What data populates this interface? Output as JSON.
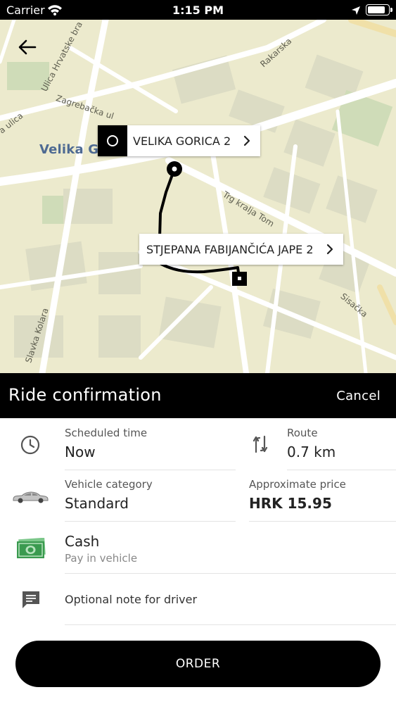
{
  "status_bar": {
    "carrier": "Carrier",
    "time": "1:15 PM",
    "battery_level": 0.9
  },
  "map": {
    "town_label": "Velika Gorica",
    "streets": [
      "Ulica Hrvatske bra",
      "Rakarska",
      "Zagrebačka ul",
      "a ulica",
      "Trg kralja Tom",
      "Sisačka",
      "Slavka Kolara"
    ],
    "origin": {
      "label": "VELIKA GORICA 2"
    },
    "destination": {
      "label": "STJEPANA FABIJANČIĆA JAPE 2"
    }
  },
  "header": {
    "title": "Ride confirmation",
    "cancel_label": "Cancel"
  },
  "details": {
    "scheduled_time": {
      "label": "Scheduled time",
      "value": "Now"
    },
    "route": {
      "label": "Route",
      "value": "0.7 km"
    },
    "vehicle_category": {
      "label": "Vehicle category",
      "value": "Standard"
    },
    "approximate_price": {
      "label": "Approximate price",
      "value": "HRK 15.95"
    },
    "payment": {
      "value": "Cash",
      "sub": "Pay in vehicle"
    },
    "note": {
      "placeholder": "Optional note for driver"
    }
  },
  "order_button": {
    "label": "ORDER"
  },
  "colors": {
    "primary": "#000000",
    "map_land": "#eceacd",
    "map_road": "#ffffff",
    "map_block": "#d9d9c2",
    "town_label": "#4e6a92",
    "cash_green": "#3a9a4f"
  }
}
